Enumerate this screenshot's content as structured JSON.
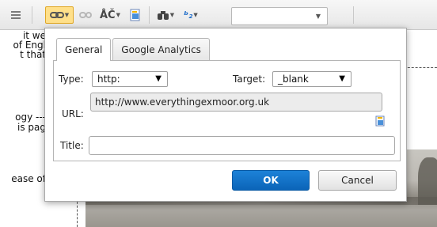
{
  "toolbar": {
    "font_family_value": "",
    "spellcheck_label": "ÅČ"
  },
  "editor": {
    "visible_text_fragments": [
      "it we",
      "of Engl",
      "t that",
      "ogy ---",
      "is pag",
      "ease of"
    ]
  },
  "dialog": {
    "tabs": [
      {
        "label": "General",
        "active": true
      },
      {
        "label": "Google Analytics",
        "active": false
      }
    ],
    "type_label": "Type:",
    "type_value": "http:",
    "target_label": "Target:",
    "target_value": "_blank",
    "url_label": "URL:",
    "url_value": "http://www.everythingexmoor.org.uk",
    "title_label": "Title:",
    "title_value": "",
    "ok_label": "OK",
    "cancel_label": "Cancel"
  },
  "colors": {
    "ok_button": "#0b64b8",
    "toolbar_active": "#ffe08a"
  }
}
